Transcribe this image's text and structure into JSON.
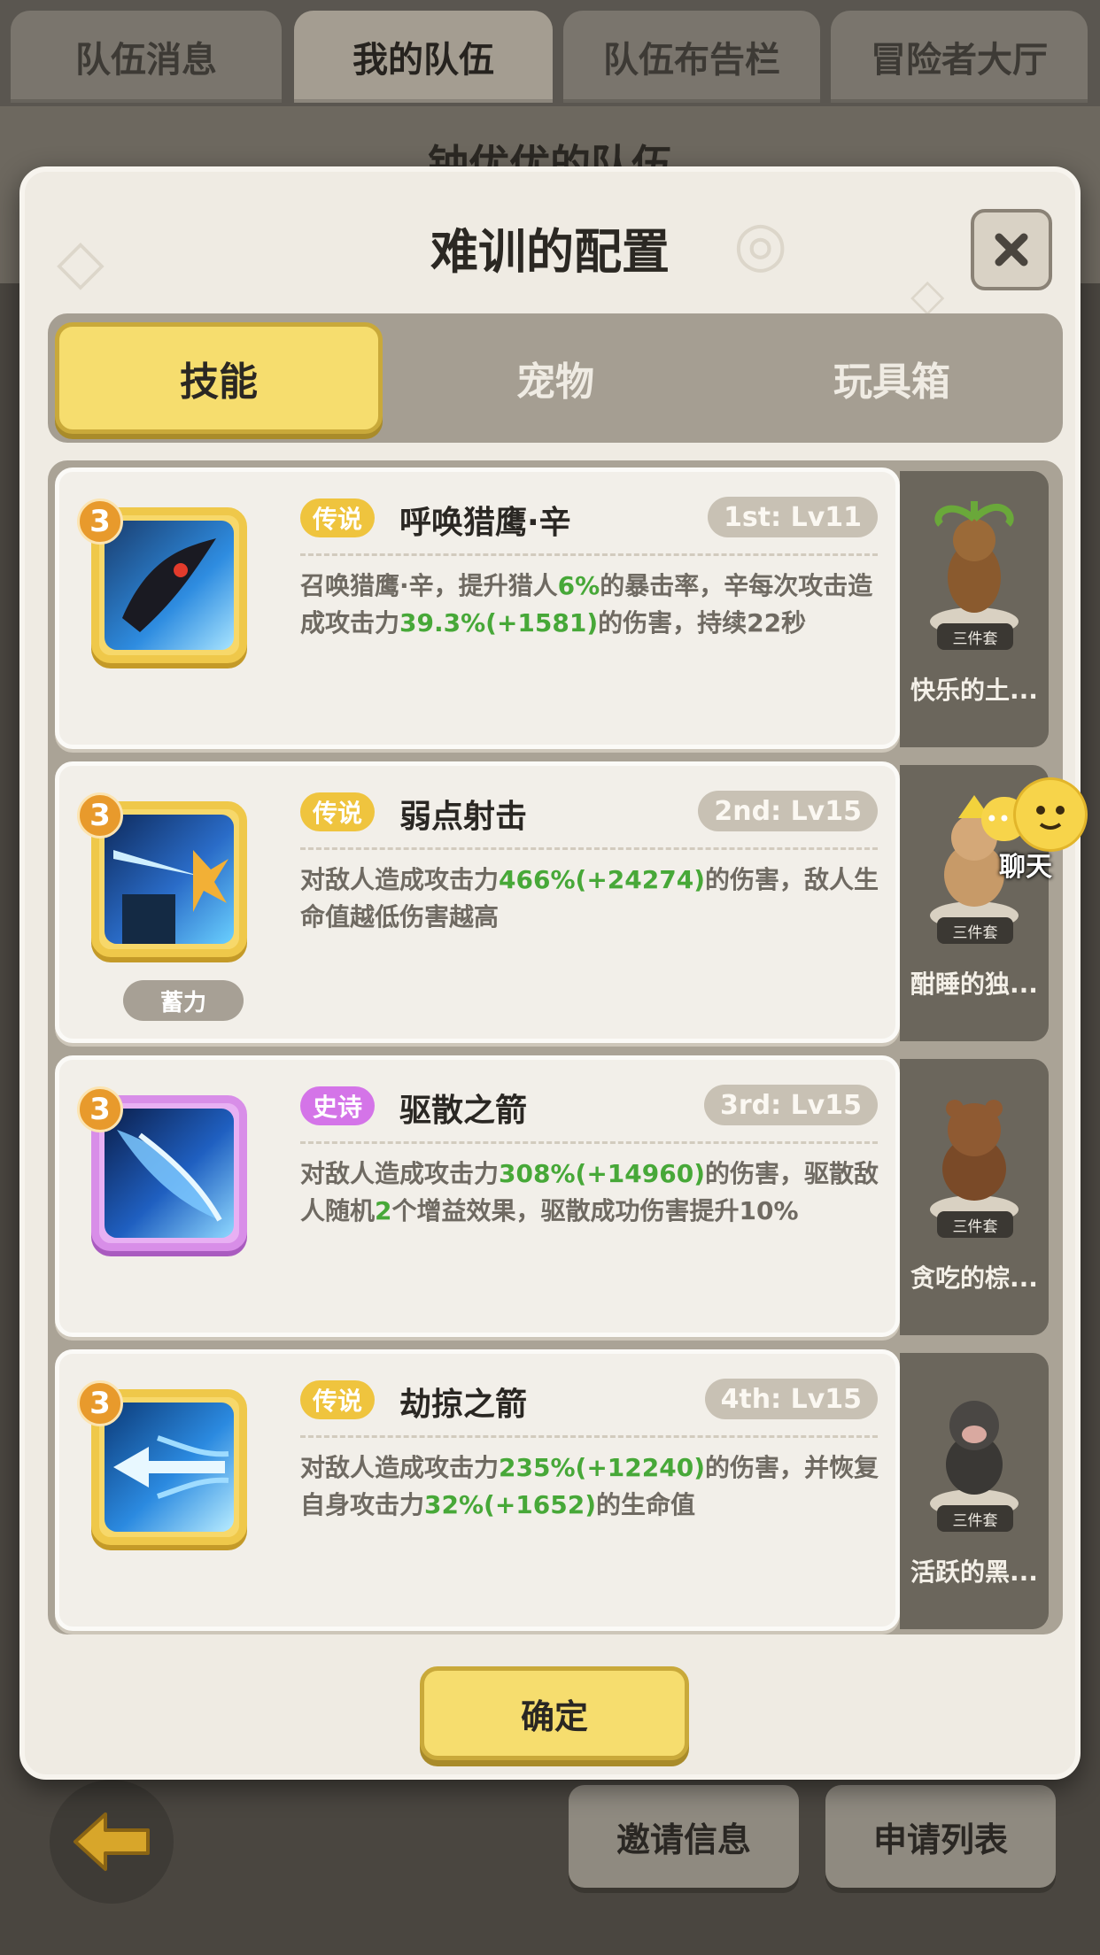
{
  "top_tabs": [
    "队伍消息",
    "我的队伍",
    "队伍布告栏",
    "冒险者大厅"
  ],
  "background_title": "钟优优的队伍",
  "modal": {
    "title": "难训的配置",
    "tabs": [
      "技能",
      "宠物",
      "玩具箱"
    ],
    "active_tab": "技能",
    "confirm_label": "确定"
  },
  "skills": [
    {
      "level_badge": "3",
      "rarity": "传说",
      "name": "呼唤猎鹰·辛",
      "slot": "1st: Lv11",
      "desc_parts": [
        "召唤猎鹰·辛，提升猎人",
        "6%",
        "的暴击率，辛每次攻击造成攻击力",
        "39.3%(+1581)",
        "的伤害，持续22秒"
      ],
      "tag": ""
    },
    {
      "level_badge": "3",
      "rarity": "传说",
      "name": "弱点射击",
      "slot": "2nd: Lv15",
      "desc_parts": [
        "对敌人造成攻击力",
        "466%(+24274)",
        "的伤害，敌人生命值越低伤害越高",
        "",
        ""
      ],
      "tag": "蓄力"
    },
    {
      "level_badge": "3",
      "rarity": "史诗",
      "name": "驱散之箭",
      "slot": "3rd: Lv15",
      "desc_parts": [
        "对敌人造成攻击力",
        "308%(+14960)",
        "的伤害，驱散敌人随机",
        "2",
        "个增益效果，驱散成功伤害提升10%"
      ],
      "tag": ""
    },
    {
      "level_badge": "3",
      "rarity": "传说",
      "name": "劫掠之箭",
      "slot": "4th: Lv15",
      "desc_parts": [
        "对敌人造成攻击力",
        "235%(+12240)",
        "的伤害，并恢复自身攻击力",
        "32%(+1652)",
        "的生命值"
      ],
      "tag": ""
    }
  ],
  "toys": [
    {
      "name": "快乐的土...",
      "tag": "三件套"
    },
    {
      "name": "酣睡的独...",
      "tag": "三件套"
    },
    {
      "name": "贪吃的棕...",
      "tag": "三件套"
    },
    {
      "name": "活跃的黑...",
      "tag": "三件套"
    }
  ],
  "chat": {
    "dots": "•••",
    "label": "聊天"
  },
  "bottom_buttons": {
    "invite": "邀请信息",
    "apply": "申请列表"
  },
  "colors": {
    "legend": "#efc43e",
    "epic": "#d474e8",
    "accent_yellow": "#f6dd6e",
    "green_value": "#47a838"
  }
}
